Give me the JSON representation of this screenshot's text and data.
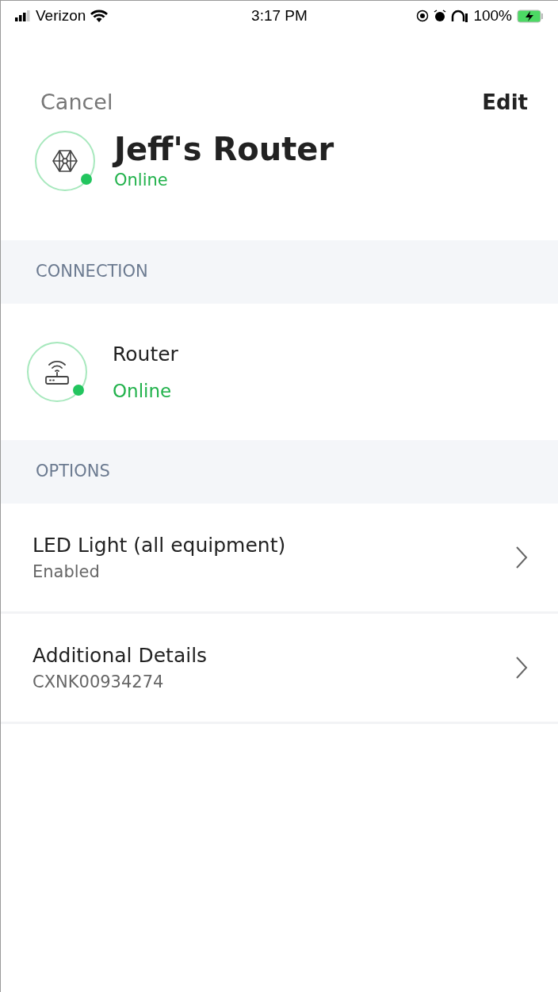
{
  "status_bar": {
    "carrier": "Verizon",
    "time": "3:17 PM",
    "battery": "100%"
  },
  "nav": {
    "cancel": "Cancel",
    "edit": "Edit"
  },
  "device": {
    "name": "Jeff's Router",
    "status": "Online",
    "online": true
  },
  "connection": {
    "heading": "CONNECTION",
    "name": "Router",
    "status": "Online",
    "online": true
  },
  "options": {
    "heading": "OPTIONS",
    "items": [
      {
        "title": "LED Light (all equipment)",
        "value": "Enabled"
      },
      {
        "title": "Additional Details",
        "value": "CXNK00934274"
      }
    ]
  }
}
